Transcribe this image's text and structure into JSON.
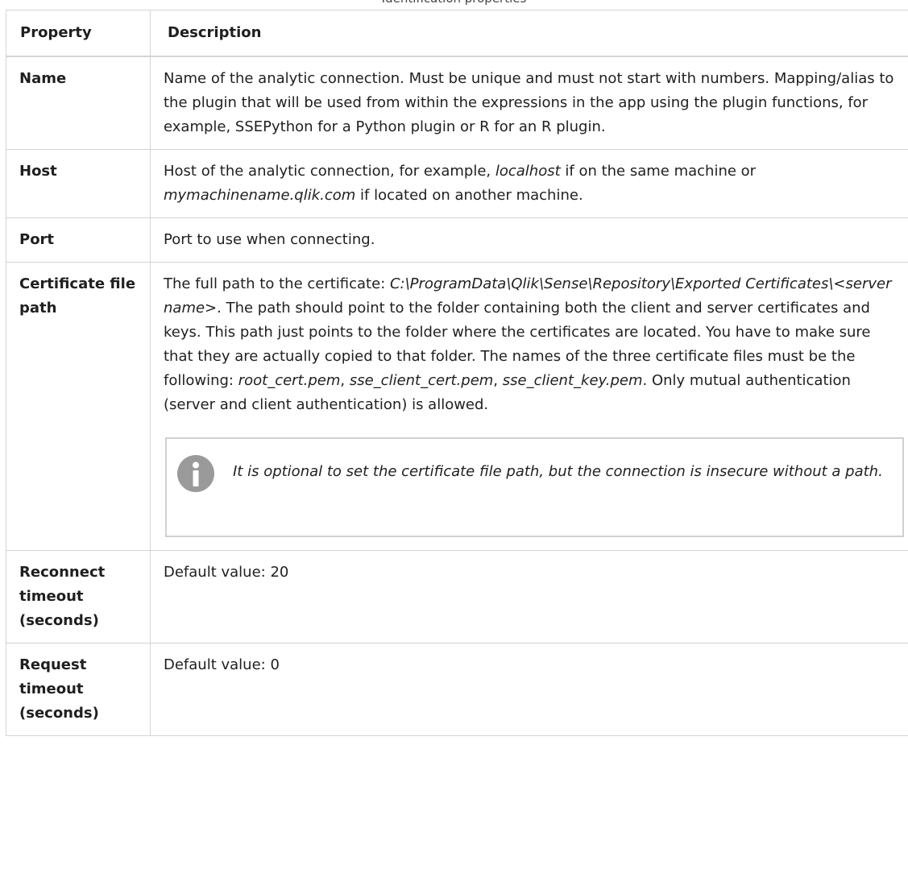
{
  "caption": "Identification properties",
  "table": {
    "headers": {
      "property": "Property",
      "description": "Description"
    },
    "rows": {
      "name": {
        "property": "Name",
        "description": "Name of the analytic connection. Must be unique and must not start with numbers. Mapping/alias to the plugin that will be used from within the expressions in the app using the plugin functions, for example, SSEPython for a Python plugin or R for an R plugin."
      },
      "host": {
        "property": "Host",
        "d1": "Host of the analytic connection, for example, ",
        "d2": "localhost",
        "d3": " if on the same machine or ",
        "d4": "mymachinename.qlik.com",
        "d5": " if located on another machine."
      },
      "port": {
        "property": "Port",
        "description": "Port to use when connecting."
      },
      "cert": {
        "property": "Certificate file path",
        "d1": "The full path to the certificate: ",
        "d2": "C:\\ProgramData\\Qlik\\Sense\\Repository\\Exported Certificates\\<server name>",
        "d3": ". The path should point to the folder containing both the client and server certificates and keys. This path just points to the folder where the certificates are located. You have to make sure that they are actually copied to that folder. The names of the three certificate files must be the following: ",
        "d4": "root_cert.pem",
        "d5": ", ",
        "d6": "sse_client_cert.pem",
        "d7": ", ",
        "d8": "sse_client_key.pem",
        "d9": ". Only mutual authentication (server and client authentication) is allowed.",
        "note": "It is optional to set the certificate file path, but the connection is insecure without a path.",
        "note_icon": "info-icon"
      },
      "reconnect": {
        "property": "Reconnect timeout (seconds)",
        "description": "Default value: 20"
      },
      "request": {
        "property": "Request timeout (seconds)",
        "description": "Default value: 0"
      }
    }
  },
  "colors": {
    "border": "#d4d4d4",
    "note_border": "#d0d0d0",
    "icon_gray": "#9a9a9a"
  }
}
